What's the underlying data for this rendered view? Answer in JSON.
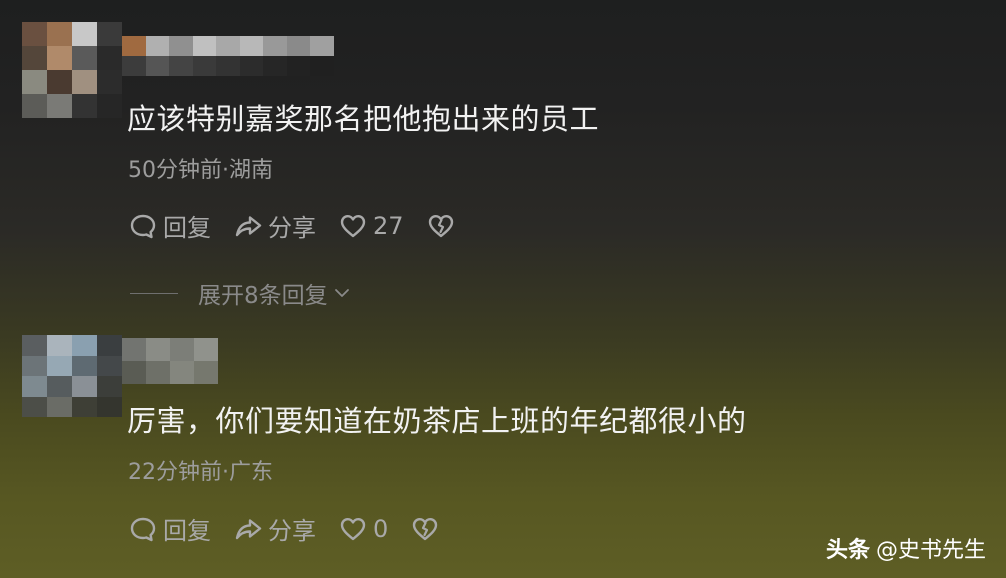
{
  "comments": [
    {
      "text": "应该特别嘉奖那名把他抱出来的员工",
      "meta": "50分钟前·湖南",
      "reply_label": "回复",
      "share_label": "分享",
      "like_count": "27",
      "expand_label": "展开8条回复"
    },
    {
      "text": "厉害，你们要知道在奶茶店上班的年纪都很小的",
      "meta": "22分钟前·广东",
      "reply_label": "回复",
      "share_label": "分享",
      "like_count": "0"
    }
  ],
  "watermark": {
    "brand": "头条",
    "author": "@史书先生"
  },
  "icons": {
    "reply": "comment-bubble-icon",
    "share": "share-arrow-icon",
    "like": "heart-icon",
    "dislike": "broken-heart-icon",
    "expand": "chevron-down-icon"
  },
  "colors": {
    "text_primary": "#f2f2f2",
    "text_secondary": "#9d9d9d",
    "action_gray": "#a9a9a9"
  }
}
